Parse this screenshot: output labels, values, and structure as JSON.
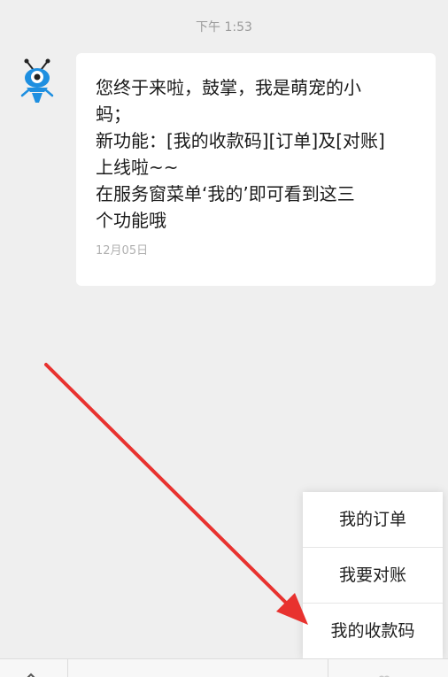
{
  "chat": {
    "time_label": "下午 1:53",
    "message": {
      "text": "您终于来啦，鼓掌，我是萌宠的小\n蚂；\n新功能：[我的收款码][订单]及[对账]\n上线啦~~\n在服务窗菜单‘我的’即可看到这三\n个功能哦",
      "date": "12月05日"
    }
  },
  "menu": {
    "items": [
      {
        "label": "我的订单"
      },
      {
        "label": "我要对账"
      },
      {
        "label": "我的收款码"
      }
    ]
  },
  "icons": {
    "avatar": "ant-mascot-icon",
    "annotation": "red-arrow",
    "bottom_left": "chevron-up-icon",
    "bottom_right": "heart-outline-icon"
  },
  "colors": {
    "background": "#efefef",
    "bubble": "#ffffff",
    "arrow": "#e8322f",
    "avatar_blue": "#1e8fe0"
  }
}
